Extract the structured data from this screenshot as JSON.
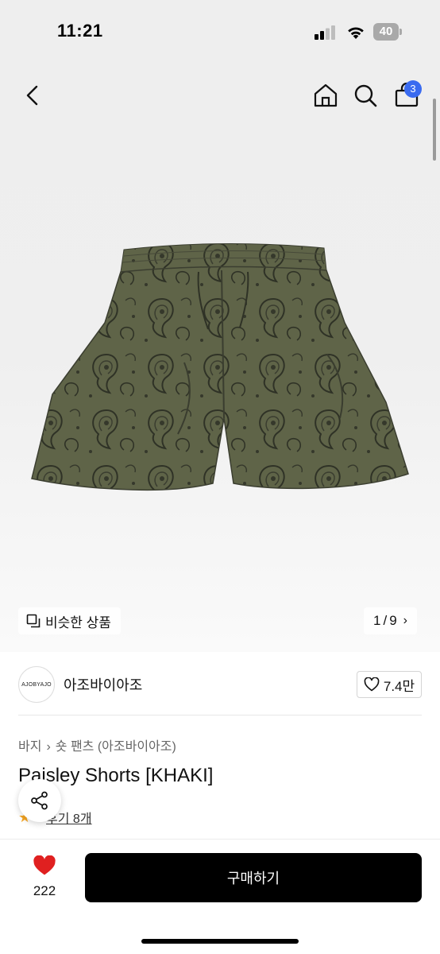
{
  "status_bar": {
    "time": "11:21",
    "battery": "40"
  },
  "header": {
    "cart_count": "3"
  },
  "gallery": {
    "similar_label": "비슷한 상품",
    "current_page": "1",
    "page_separator": "/",
    "total_pages": "9"
  },
  "brand": {
    "logo_text": "AJOBYAJO",
    "name": "아조바이아조",
    "likes": "7.4만"
  },
  "breadcrumb": {
    "category": "바지",
    "subcategory": "숏 팬츠 (아조바이아조)"
  },
  "product": {
    "title": "Paisley Shorts [KHAKI]",
    "rating": "5",
    "reviews_label": "후기 8개"
  },
  "bottom_bar": {
    "wishlist_count": "222",
    "buy_label": "구매하기"
  },
  "colors": {
    "accent_badge": "#3a6bf0",
    "buy_button": "#000000",
    "heart": "#e02020",
    "star": "#f6a623"
  },
  "icons": [
    "back-icon",
    "home-icon",
    "search-icon",
    "shopping-bag-icon",
    "similar-items-icon",
    "heart-outline-icon",
    "share-icon",
    "heart-filled-icon",
    "star-icon"
  ]
}
